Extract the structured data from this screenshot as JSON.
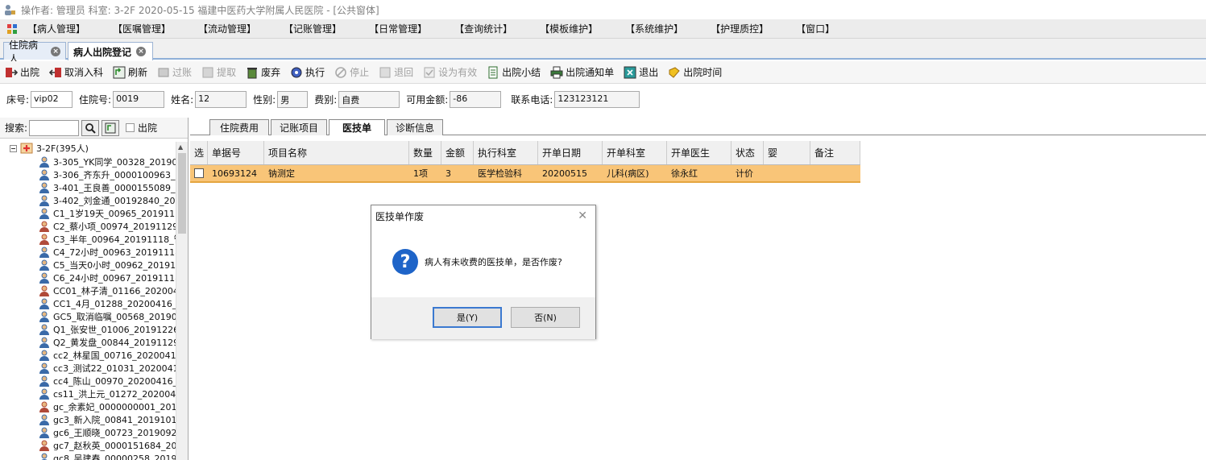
{
  "window": {
    "title": "操作者: 管理员 科室: 3-2F 2020-05-15 福建中医药大学附属人民医院 - [公共窗体]"
  },
  "menu": [
    "【病人管理】",
    "【医嘱管理】",
    "【流动管理】",
    "【记账管理】",
    "【日常管理】",
    "【查询统计】",
    "【模板维护】",
    "【系统维护】",
    "【护理质控】",
    "【窗口】"
  ],
  "doc_tabs": [
    {
      "label": "住院病人"
    },
    {
      "label": "病人出院登记"
    }
  ],
  "toolbar": [
    {
      "label": "出院",
      "icon": "discharge-icon",
      "enabled": true
    },
    {
      "label": "取消入科",
      "icon": "cancel-admit-icon",
      "enabled": true
    },
    {
      "label": "刷新",
      "icon": "refresh-icon",
      "enabled": true
    },
    {
      "label": "过账",
      "icon": "post-icon",
      "enabled": false
    },
    {
      "label": "提取",
      "icon": "extract-icon",
      "enabled": false
    },
    {
      "label": "废弃",
      "icon": "trash-icon",
      "enabled": true
    },
    {
      "label": "执行",
      "icon": "execute-icon",
      "enabled": true
    },
    {
      "label": "停止",
      "icon": "stop-icon",
      "enabled": false
    },
    {
      "label": "退回",
      "icon": "return-icon",
      "enabled": false
    },
    {
      "label": "设为有效",
      "icon": "validate-icon",
      "enabled": false
    },
    {
      "label": "出院小结",
      "icon": "summary-icon",
      "enabled": true
    },
    {
      "label": "出院通知单",
      "icon": "print-icon",
      "enabled": true
    },
    {
      "label": "退出",
      "icon": "exit-icon",
      "enabled": true
    },
    {
      "label": "出院时间",
      "icon": "time-icon",
      "enabled": true
    }
  ],
  "patient": {
    "bed_label": "床号:",
    "bed": "vip02",
    "admno_label": "住院号:",
    "admno": "0019",
    "name_label": "姓名:",
    "name": "12",
    "sex_label": "性别:",
    "sex": "男",
    "fee_label": "费别:",
    "fee": "自费",
    "balance_label": "可用金额:",
    "balance": "-86",
    "phone_label": "联系电话:",
    "phone": "123123121"
  },
  "search": {
    "label": "搜索:",
    "value": "",
    "discharged_label": "出院"
  },
  "tree": {
    "root": "3-2F(395人)",
    "items": [
      {
        "label": "3-305_YK同学_00328_201904",
        "gender": "m"
      },
      {
        "label": "3-306_齐东升_0000100963_2",
        "gender": "m"
      },
      {
        "label": "3-401_王良善_0000155089_2",
        "gender": "m"
      },
      {
        "label": "3-402_刘金通_00192840_201",
        "gender": "m"
      },
      {
        "label": "C1_1岁19天_00965_20191118",
        "gender": "m"
      },
      {
        "label": "C2_蔡小项_00974_20191129_",
        "gender": "f"
      },
      {
        "label": "C3_半年_00964_20191118_管",
        "gender": "f"
      },
      {
        "label": "C4_72小时_00963_20191118_",
        "gender": "m"
      },
      {
        "label": "C5_当天0小时_00962_201911",
        "gender": "m"
      },
      {
        "label": "C6_24小时_00967_20191118_",
        "gender": "m"
      },
      {
        "label": "CC01_林子清_01166_2020042",
        "gender": "f"
      },
      {
        "label": "CC1_4月_01288_20200416_管",
        "gender": "m"
      },
      {
        "label": "GC5_取消临嘱_00568_201907",
        "gender": "m"
      },
      {
        "label": "Q1_张安世_01006_20191226_",
        "gender": "m"
      },
      {
        "label": "Q2_黄发盘_00844_20191129_",
        "gender": "m"
      },
      {
        "label": "cc2_林星国_00716_20200416",
        "gender": "m"
      },
      {
        "label": "cc3_测试22_01031_20200416",
        "gender": "m"
      },
      {
        "label": "cc4_陈山_00970_20200416_管",
        "gender": "m"
      },
      {
        "label": "cs11_洪上元_01272_2020040",
        "gender": "m"
      },
      {
        "label": "gc_余素妃_0000000001_2016",
        "gender": "f"
      },
      {
        "label": "gc3_新入院_00841_20191017",
        "gender": "m"
      },
      {
        "label": "gc6_王顺晓_00723_20190920",
        "gender": "m"
      },
      {
        "label": "gc7_赵秋英_0000151684_201",
        "gender": "f"
      },
      {
        "label": "gc8_吴建春_00000258_20191",
        "gender": "m"
      }
    ]
  },
  "inner_tabs": [
    {
      "label": "住院费用"
    },
    {
      "label": "记账项目"
    },
    {
      "label": "医技单"
    },
    {
      "label": "诊断信息"
    }
  ],
  "grid": {
    "columns": [
      "选",
      "单据号",
      "项目名称",
      "数量",
      "金额",
      "执行科室",
      "开单日期",
      "开单科室",
      "开单医生",
      "状态",
      "婴",
      "备注"
    ],
    "rows": [
      [
        "",
        "10693124",
        "钠测定",
        "1项",
        "3",
        "医学检验科",
        "20200515",
        "儿科(病区)",
        "徐永红",
        "计价",
        "",
        ""
      ]
    ]
  },
  "dialog": {
    "title": "医技单作废",
    "message": "病人有未收费的医技单，是否作废?",
    "yes": "是(Y)",
    "no": "否(N)"
  },
  "colors": {
    "row_highlight": "#f9c578",
    "question_blue": "#1e64c8",
    "tab_border": "#8fb0d8"
  }
}
